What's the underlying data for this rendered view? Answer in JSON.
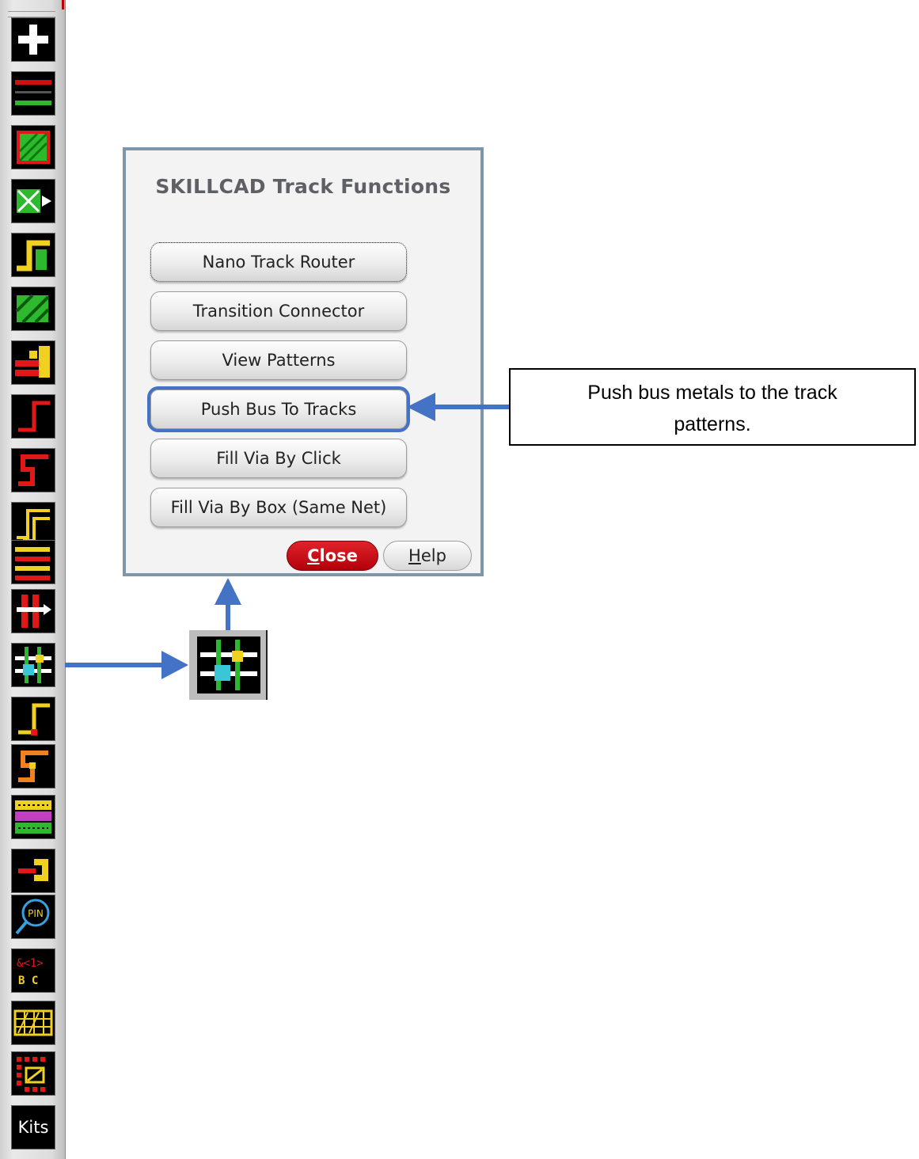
{
  "toolbar": {
    "buttons": [
      {
        "name": "add-icon"
      },
      {
        "name": "parallel-lines-icon"
      },
      {
        "name": "fill-shape-icon"
      },
      {
        "name": "move-pattern-icon"
      },
      {
        "name": "step-route-icon"
      },
      {
        "name": "hatch-fill-icon"
      },
      {
        "name": "stack-icon"
      },
      {
        "name": "corner-route-icon"
      },
      {
        "name": "step-route-red-icon"
      },
      {
        "name": "double-step-icon"
      },
      {
        "name": "bus-lines-icon"
      },
      {
        "name": "bus-move-icon"
      },
      {
        "name": "track-functions-icon"
      },
      {
        "name": "corner-route-yellow-icon"
      },
      {
        "name": "step-route-orange-icon"
      },
      {
        "name": "via-array-icon"
      },
      {
        "name": "connector-icon"
      },
      {
        "name": "pin-search-icon"
      },
      {
        "name": "bus-label-icon"
      },
      {
        "name": "grid-pattern-icon"
      },
      {
        "name": "dot-array-icon"
      }
    ],
    "bus_label_line1": "&<1>",
    "bus_label_line2": "B C",
    "pin_text": "PIN",
    "kits_label": "Kits"
  },
  "dialog": {
    "title": "SKILLCAD Track Functions",
    "buttons": [
      {
        "label": "Nano Track Router"
      },
      {
        "label": "Transition Connector"
      },
      {
        "label": "View Patterns"
      },
      {
        "label": "Push Bus To Tracks"
      },
      {
        "label": "Fill Via By Click"
      },
      {
        "label": "Fill Via By Box (Same Net)"
      }
    ],
    "close_mnemonic": "C",
    "close_rest": "lose",
    "help_mnemonic": "H",
    "help_rest": "elp"
  },
  "callout": {
    "line1": "Push bus metals to the track",
    "line2": "patterns."
  },
  "colors": {
    "arrow": "#4472c4",
    "dialog_border": "#7d96a8",
    "close_red": "#c8101a"
  }
}
